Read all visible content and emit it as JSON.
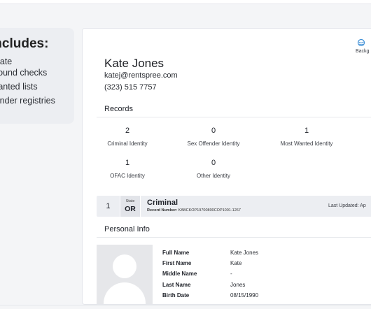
{
  "sidebar_card": {
    "title": "includes:",
    "items": [
      "-state",
      "ground checks",
      "Wanted lists",
      "ffender registries"
    ]
  },
  "report": {
    "background_check_label": "Backg",
    "applicant": {
      "name": "Kate Jones",
      "email": "katej@rentspree.com",
      "phone": "(323) 515 7757"
    },
    "records_title": "Records",
    "records": [
      {
        "count": "2",
        "label": "Criminal Identity"
      },
      {
        "count": "0",
        "label": "Sex Offender Identity"
      },
      {
        "count": "1",
        "label": "Most Wanted Identity"
      },
      {
        "count": "1",
        "label": "OFAC Identity"
      },
      {
        "count": "0",
        "label": "Other Identity"
      }
    ],
    "criminal_row": {
      "count": "1",
      "state_label": "State",
      "state_value": "OR",
      "title": "Criminal",
      "record_number_label": "Record Number:",
      "record_number": "KABCKOP19700800COP1001-1267",
      "last_updated_label": "Last Updated:",
      "last_updated_value": "Ap"
    },
    "personal_info_title": "Personal Info",
    "personal_info": [
      {
        "label": "Full Name",
        "value": "Kate Jones"
      },
      {
        "label": "First Name",
        "value": "Kate"
      },
      {
        "label": "Middle Name",
        "value": "-"
      },
      {
        "label": "Last Name",
        "value": "Jones"
      },
      {
        "label": "Birth Date",
        "value": "08/15/1990"
      }
    ]
  },
  "colors": {
    "accent": "#3d8fd6",
    "card_gray": "#eceef2",
    "avatar_gray": "#e6e7ea"
  },
  "icons": {
    "background_check": "shield-globe-icon",
    "avatar": "user-silhouette-icon"
  }
}
